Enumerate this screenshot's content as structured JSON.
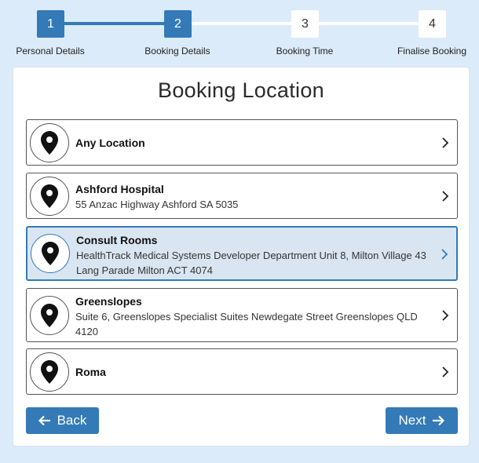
{
  "stepper": {
    "steps": [
      {
        "number": "1",
        "label": "Personal Details",
        "state": "done"
      },
      {
        "number": "2",
        "label": "Booking Details",
        "state": "current"
      },
      {
        "number": "3",
        "label": "Booking Time",
        "state": "todo"
      },
      {
        "number": "4",
        "label": "Finalise Booking",
        "state": "todo"
      }
    ]
  },
  "page": {
    "title": "Booking Location"
  },
  "locations": [
    {
      "name": "Any Location",
      "address": "",
      "selected": false
    },
    {
      "name": "Ashford Hospital",
      "address": "55 Anzac Highway Ashford SA 5035",
      "selected": false
    },
    {
      "name": "Consult Rooms",
      "address": "HealthTrack Medical Systems Developer Department Unit 8, Milton Village 43 Lang Parade Milton ACT 4074",
      "selected": true
    },
    {
      "name": "Greenslopes",
      "address": "Suite 6, Greenslopes Specialist Suites Newdegate Street Greenslopes QLD 4120",
      "selected": false
    },
    {
      "name": "Roma",
      "address": "",
      "selected": false
    }
  ],
  "nav": {
    "back_label": "Back",
    "next_label": "Next"
  },
  "icons": {
    "location": "map-pin-icon",
    "chevron": "chevron-right-icon",
    "back": "arrow-left-icon",
    "next": "arrow-right-icon"
  },
  "colors": {
    "accent": "#337ab7",
    "background": "#dcebf9",
    "selected_bg": "#d9e6f2"
  }
}
